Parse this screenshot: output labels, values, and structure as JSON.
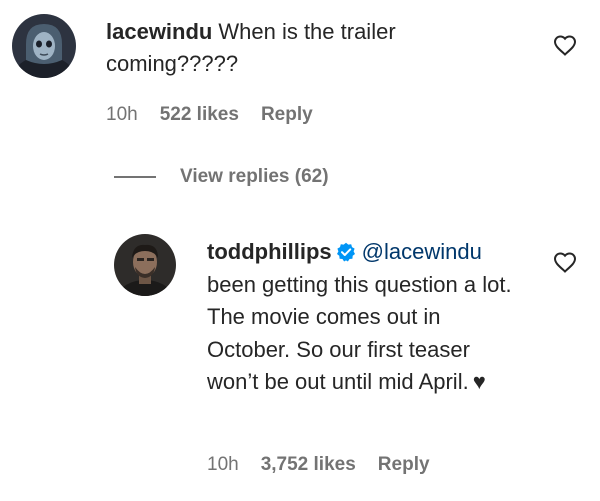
{
  "comments": [
    {
      "username": "lacewindu",
      "text": "When is the trailer coming?????",
      "time": "10h",
      "likes": "522 likes",
      "reply_label": "Reply"
    }
  ],
  "view_replies": {
    "label": "View replies (62)"
  },
  "reply": {
    "username": "toddphillips",
    "verified": true,
    "mention": "@lacewindu",
    "text": "been getting this question a lot. The movie comes out in October. So our first teaser won’t be out until mid April.",
    "emoji": "♥",
    "time": "10h",
    "likes": "3,752 likes",
    "reply_label": "Reply"
  },
  "icons": {
    "like": "heart-outline-icon",
    "verified": "verified-badge-icon"
  },
  "colors": {
    "text": "#262626",
    "secondary": "#737373",
    "link": "#00376b",
    "verified": "#0095f6"
  }
}
